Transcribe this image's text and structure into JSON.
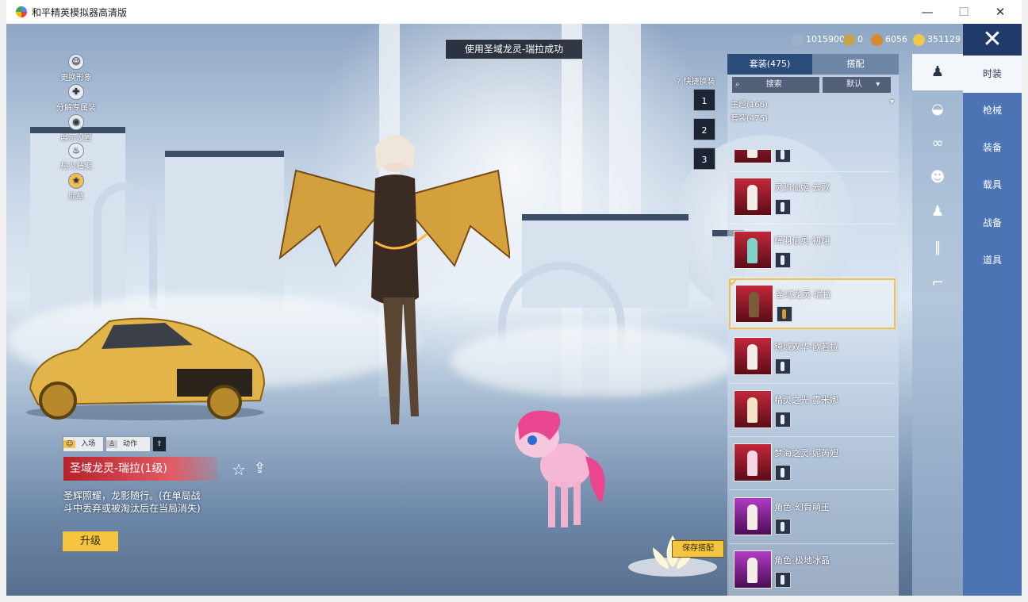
{
  "window": {
    "title": "和平精英模拟器高清版",
    "min_glyph": "—",
    "max_glyph": "☐",
    "close_glyph": "✕"
  },
  "banner": "使用圣域龙灵-瑞拉成功",
  "currency": [
    {
      "icon": "silver-coupon-icon",
      "value": "1015900",
      "color": "#9fb0c8"
    },
    {
      "icon": "bp-coin-icon",
      "value": "0",
      "color": "#c4a44a"
    },
    {
      "icon": "honor-coin-icon",
      "value": "6056",
      "color": "#d58a2c"
    },
    {
      "icon": "gold-coupon-icon",
      "value": "351129",
      "color": "#f0c74a"
    }
  ],
  "close_glyph": "✕",
  "left_menu": [
    {
      "label": "更换形象",
      "icon": "avatar-icon",
      "glyph": "☺"
    },
    {
      "label": "分解专属装",
      "icon": "puzzle-icon",
      "glyph": "✚"
    },
    {
      "label": "展示设置",
      "icon": "eye-icon",
      "glyph": "◉"
    },
    {
      "label": "热力档案",
      "icon": "flame-icon",
      "glyph": "♨"
    },
    {
      "label": "勋章",
      "icon": "medal-icon",
      "glyph": "★"
    }
  ],
  "quick_swap": {
    "label": "快捷换装",
    "help_glyph": "?",
    "slots": [
      "1",
      "2",
      "3"
    ]
  },
  "panel": {
    "tab_suits": "套装(475)",
    "tab_match": "搭配",
    "search_label": "搜索",
    "sort_label": "默认",
    "filter_theme": "主题(166)",
    "filter_suits": "套装(475)",
    "caret": "▾"
  },
  "outfits": [
    {
      "name": "",
      "frame": "red"
    },
    {
      "name": "灵驹仙姬-云歌",
      "frame": "red"
    },
    {
      "name": "辉羽信灵-初翊",
      "frame": "red"
    },
    {
      "name": "圣域龙灵-瑞拉",
      "frame": "red",
      "selected": true
    },
    {
      "name": "镜域双华-欧若拉",
      "frame": "red"
    },
    {
      "name": "精灵之光-露米娜",
      "frame": "red"
    },
    {
      "name": "梦海之灵-妮芮妲",
      "frame": "red"
    },
    {
      "name": "角色-幻骨萌王",
      "frame": "purple"
    },
    {
      "name": "角色-极地冰晶",
      "frame": "purple"
    }
  ],
  "category_icons": [
    "outfit-icon",
    "cap-icon",
    "goggles-icon",
    "face-icon",
    "suit-icon",
    "pants-icon",
    "shoes-icon"
  ],
  "category_glyphs": [
    "♟",
    "◒",
    "∞",
    "☻",
    "♟",
    "∥",
    "⌐"
  ],
  "right_menu": [
    "时装",
    "枪械",
    "装备",
    "载具",
    "战备",
    "道具"
  ],
  "actions": {
    "entry_label": "入场",
    "action_label": "动作",
    "entry_glyph": "☺",
    "action_glyph": "♙",
    "extra_glyph": "⇧"
  },
  "item": {
    "name": "圣域龙灵-瑞拉(1级)",
    "description": "圣辉照耀，龙影随行。(在单局战斗中丢弃或被淘汰后在当局消失)",
    "upgrade_label": "升级",
    "star_glyph": "☆",
    "share_glyph": "⇪"
  },
  "save_label": "保存搭配"
}
